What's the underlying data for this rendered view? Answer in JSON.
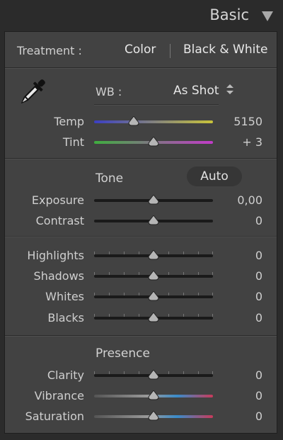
{
  "panel_title": "Basic",
  "treatment": {
    "label": "Treatment :",
    "options": [
      "Color",
      "Black & White"
    ],
    "selected": "Color"
  },
  "wb": {
    "label": "WB :",
    "value": "As Shot"
  },
  "temp": {
    "label": "Temp",
    "value": "5150",
    "position": 0.33
  },
  "tint": {
    "label": "Tint",
    "value": "+ 3",
    "position": 0.5
  },
  "tone": {
    "title": "Tone",
    "auto_label": "Auto"
  },
  "exposure": {
    "label": "Exposure",
    "value": "0,00",
    "position": 0.5
  },
  "contrast": {
    "label": "Contrast",
    "value": "0",
    "position": 0.5
  },
  "highlights": {
    "label": "Highlights",
    "value": "0",
    "position": 0.5
  },
  "shadows": {
    "label": "Shadows",
    "value": "0",
    "position": 0.5
  },
  "whites": {
    "label": "Whites",
    "value": "0",
    "position": 0.5
  },
  "blacks": {
    "label": "Blacks",
    "value": "0",
    "position": 0.5
  },
  "presence": {
    "title": "Presence"
  },
  "clarity": {
    "label": "Clarity",
    "value": "0",
    "position": 0.5
  },
  "vibrance": {
    "label": "Vibrance",
    "value": "0",
    "position": 0.5
  },
  "saturation": {
    "label": "Saturation",
    "value": "0",
    "position": 0.5
  },
  "colors": {
    "temp_gradient": [
      "#3b3fc4",
      "#c9c43a"
    ],
    "tint_gradient": [
      "#3fae3f",
      "#c23bc9"
    ],
    "vibrance_gradient": [
      "#555555",
      "#9a9a9a",
      "#3a8bc9",
      "#c93a5a"
    ]
  },
  "icons": {
    "wb_picker": "eyedropper-icon",
    "collapse": "triangle-down-icon",
    "updown": "updown-arrows-icon"
  }
}
